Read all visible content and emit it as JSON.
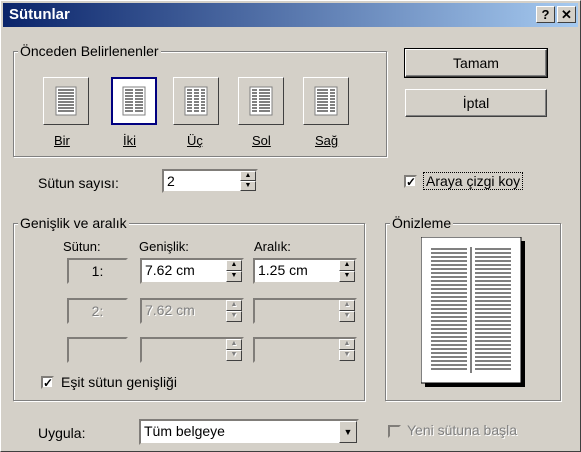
{
  "window": {
    "title": "Sütunlar",
    "help_button": "?",
    "close_button": "✕"
  },
  "presets": {
    "group_label": "Önceden Belirlenenler",
    "items": [
      {
        "label": "Bir"
      },
      {
        "label": "İki"
      },
      {
        "label": "Üç"
      },
      {
        "label": "Sol"
      },
      {
        "label": "Sağ"
      }
    ],
    "selected": "İki"
  },
  "buttons": {
    "ok": "Tamam",
    "cancel": "İptal"
  },
  "column_count": {
    "label": "Sütun sayısı:",
    "value": "2"
  },
  "line_between": {
    "label": "Araya çizgi koy",
    "checked": true
  },
  "width_spacing": {
    "group_label": "Genişlik ve aralık",
    "headers": {
      "column": "Sütun:",
      "width": "Genişlik:",
      "spacing": "Aralık:"
    },
    "rows": [
      {
        "column": "1:",
        "width": "7.62 cm",
        "spacing": "1.25 cm",
        "enabled": true
      },
      {
        "column": "2:",
        "width": "7.62 cm",
        "spacing": "",
        "enabled": false
      },
      {
        "column": "",
        "width": "",
        "spacing": "",
        "enabled": false
      }
    ],
    "equal_width": {
      "label": "Eşit sütun genişliği",
      "checked": true
    }
  },
  "preview": {
    "group_label": "Önizleme",
    "columns": 2
  },
  "apply_to": {
    "label": "Uygula:",
    "value": "Tüm belgeye"
  },
  "new_column": {
    "label": "Yeni sütuna başla",
    "checked": false,
    "enabled": false
  }
}
